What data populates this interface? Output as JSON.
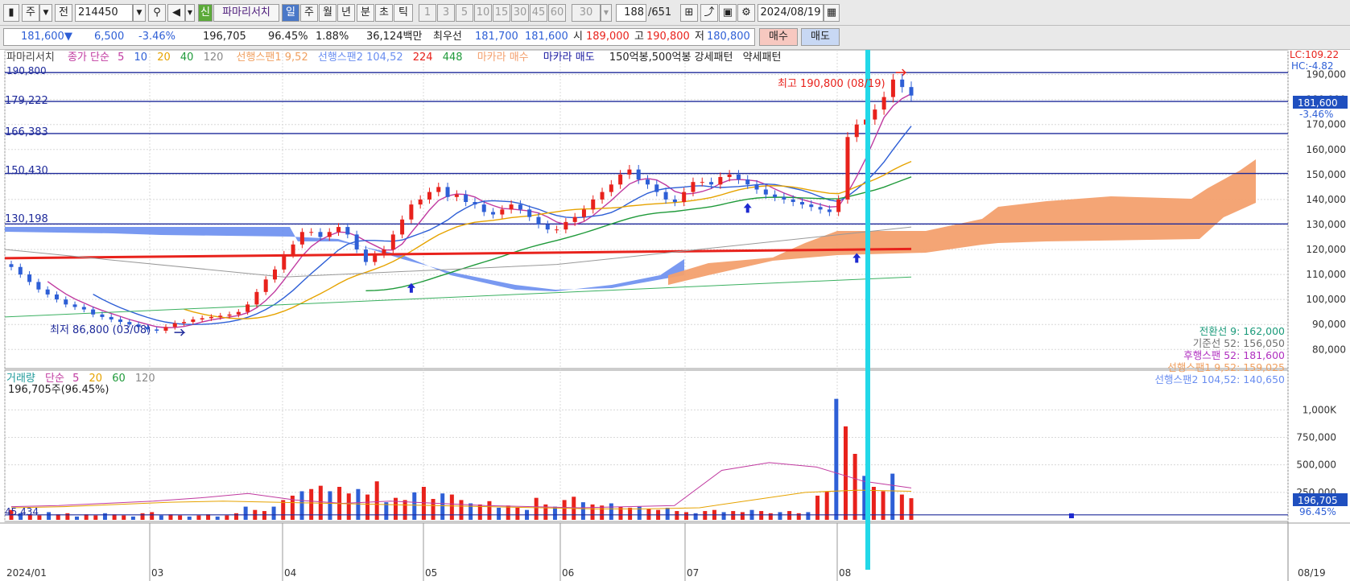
{
  "toolbar": {
    "period_label": "주",
    "prefix_label": "전",
    "code": "214450",
    "new_badge": "신",
    "stock_name": "파마리서치",
    "periods": [
      "일",
      "주",
      "월",
      "년",
      "분",
      "초",
      "틱"
    ],
    "minutes": [
      "1",
      "3",
      "5",
      "10",
      "15",
      "30",
      "45",
      "60"
    ],
    "count": "30",
    "paging": "188",
    "paging_total": "/651",
    "date": "2024/08/19"
  },
  "quote": {
    "price": "181,600",
    "arrow": "▼",
    "change": "6,500",
    "rate": "-3.46%",
    "volume": "196,705",
    "vol_ratio": "96.45%",
    "turnover_pct": "1.88%",
    "amount": "36,124백만",
    "best_label": "최우선",
    "best_ask": "181,700",
    "best_bid": "181,600",
    "open_label": "시",
    "open": "189,000",
    "high_label": "고",
    "high": "190,800",
    "low_label": "저",
    "low": "180,800",
    "buy_button": "매수",
    "sell_button": "매도"
  },
  "legend": {
    "stock": "파마리서치",
    "close_sma": "종가 단순",
    "ma": [
      "5",
      "10",
      "20",
      "40",
      "120"
    ],
    "span1": "선행스팬1 9,52",
    "span2": "선행스팬2 104,52",
    "ma224": "224",
    "ma448": "448",
    "makara_buy": "마카라 매수",
    "makara_sell": "마카라 매도",
    "pattern": "150억봉,500억봉 강세패턴",
    "weak": "약세패턴"
  },
  "volume_legend": {
    "title": "거래량",
    "sma": "단순",
    "ma": [
      "5",
      "20",
      "60",
      "120"
    ],
    "value": "196,705주(96.45%)"
  },
  "right_info": {
    "lc": "LC:109.22",
    "hc": "HC:-4.82",
    "current_price": "181,600",
    "current_rate": "-3.46%",
    "current_vol": "196,705",
    "current_vol_rate": "96.45%"
  },
  "annotations": {
    "high": "최고 190,800 (08/19)",
    "low": "최저 86,800 (03/08)",
    "level_top": "190,800",
    "left_levels": [
      "179,222",
      "166,383",
      "150,430",
      "130,198"
    ],
    "vol_left": "45,434",
    "ichimoku_info": [
      {
        "text": "전환선 9: 162,000",
        "color": "#1a9a7a"
      },
      {
        "text": "기준선 52: 156,050",
        "color": "#707070"
      },
      {
        "text": "후행스팬 52: 181,600",
        "color": "#b030c0"
      },
      {
        "text": "선행스팬1 9,52: 159,025",
        "color": "#f0a060"
      },
      {
        "text": "선행스팬2 104,52: 140,650",
        "color": "#6a8ef0"
      }
    ]
  },
  "chart_data": [
    {
      "type": "candlestick",
      "title": "파마리서치",
      "x_labels": [
        "2024/01",
        "03",
        "04",
        "05",
        "06",
        "07",
        "08",
        "08/19"
      ],
      "y_ticks": [
        80000,
        90000,
        100000,
        110000,
        120000,
        130000,
        140000,
        150000,
        160000,
        170000,
        180000,
        190000
      ],
      "ylim": [
        73000,
        196000
      ],
      "h_lines": [
        190800,
        179222,
        166383,
        150430,
        130198
      ],
      "closes": [
        113000,
        110000,
        107000,
        104000,
        102000,
        100000,
        98000,
        97000,
        96000,
        94000,
        93000,
        92000,
        91000,
        90000,
        89000,
        88000,
        87500,
        89000,
        90500,
        91000,
        92000,
        92500,
        93000,
        93500,
        94000,
        95000,
        98000,
        103000,
        108000,
        112000,
        118000,
        122000,
        127000,
        127000,
        125000,
        127000,
        129000,
        126000,
        120000,
        115000,
        118000,
        120000,
        126000,
        132000,
        138000,
        140000,
        143000,
        145000,
        141000,
        142000,
        139000,
        138000,
        135000,
        134000,
        136000,
        138000,
        136000,
        133000,
        130000,
        128000,
        128000,
        131000,
        133000,
        136000,
        140000,
        143000,
        146000,
        150000,
        152000,
        148000,
        146000,
        143000,
        140000,
        139000,
        143000,
        147000,
        147000,
        146000,
        149000,
        150000,
        148000,
        146000,
        144000,
        142000,
        141000,
        140000,
        139000,
        138000,
        137000,
        136000,
        135000,
        140000,
        165000,
        170000,
        172000,
        176000,
        181000,
        188000,
        185000,
        181600
      ],
      "high": 190800,
      "low": 86800
    },
    {
      "type": "bar",
      "title": "거래량",
      "y_ticks": [
        250000,
        500000,
        750000,
        1000000
      ],
      "ylim": [
        0,
        1200000
      ],
      "values": [
        90000,
        60000,
        50000,
        40000,
        70000,
        50000,
        60000,
        30000,
        50000,
        40000,
        60000,
        50000,
        40000,
        30000,
        60000,
        70000,
        40000,
        50000,
        40000,
        30000,
        40000,
        50000,
        30000,
        40000,
        60000,
        120000,
        90000,
        80000,
        120000,
        180000,
        220000,
        260000,
        280000,
        310000,
        260000,
        300000,
        240000,
        280000,
        230000,
        350000,
        160000,
        200000,
        180000,
        250000,
        300000,
        190000,
        240000,
        230000,
        180000,
        150000,
        140000,
        170000,
        110000,
        130000,
        110000,
        90000,
        200000,
        140000,
        120000,
        180000,
        210000,
        160000,
        140000,
        130000,
        150000,
        120000,
        110000,
        120000,
        100000,
        90000,
        110000,
        80000,
        70000,
        60000,
        80000,
        90000,
        70000,
        80000,
        70000,
        90000,
        80000,
        60000,
        70000,
        80000,
        60000,
        70000,
        220000,
        260000,
        1100000,
        850000,
        600000,
        400000,
        300000,
        260000,
        420000,
        230000,
        196705
      ],
      "ma5": [
        120000,
        130000,
        150000,
        170000,
        200000,
        240000,
        180000,
        150000,
        170000,
        150000,
        130000,
        120000,
        110000,
        120000,
        130000,
        450000,
        520000,
        480000,
        350000,
        290000
      ],
      "ma20": [
        110000,
        120000,
        140000,
        160000,
        170000,
        160000,
        150000,
        140000,
        130000,
        120000,
        110000,
        100000,
        100000,
        110000,
        180000,
        250000,
        270000,
        260000
      ]
    }
  ],
  "colors": {
    "up": "#e8221c",
    "down": "#2e5fd6",
    "cloud_up": "#f3a06e",
    "cloud_down": "#6a8ef0",
    "level": "#1e2a9a",
    "cursor": "#22d8e8"
  }
}
